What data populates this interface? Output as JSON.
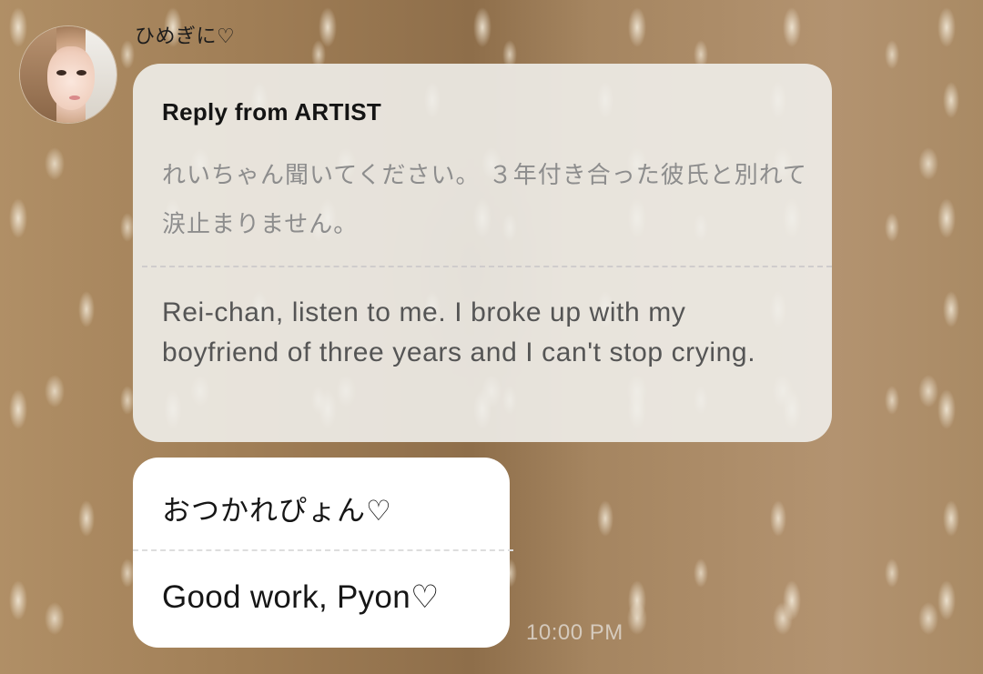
{
  "message": {
    "sender_name": "ひめぎに♡",
    "avatar_icon": "user-avatar-photo",
    "reply": {
      "header": "Reply from ARTIST",
      "original_text": "れいちゃん聞いてください。 ３年付き合った彼氏と別れて涙止まりません。",
      "translated_text": "Rei-chan, listen to me. I broke up with my boyfriend of three years and I can't stop crying."
    },
    "body": {
      "original_text": "おつかれぴょん♡",
      "translated_text": "Good work, Pyon♡"
    },
    "timestamp": "10:00 PM"
  },
  "colors": {
    "reply_bubble_bg": "#f0eeea",
    "message_bubble_bg": "#ffffff",
    "muted_text": "#8d8d8d",
    "translation_text": "#555555",
    "background_fur": "#a3835c"
  }
}
